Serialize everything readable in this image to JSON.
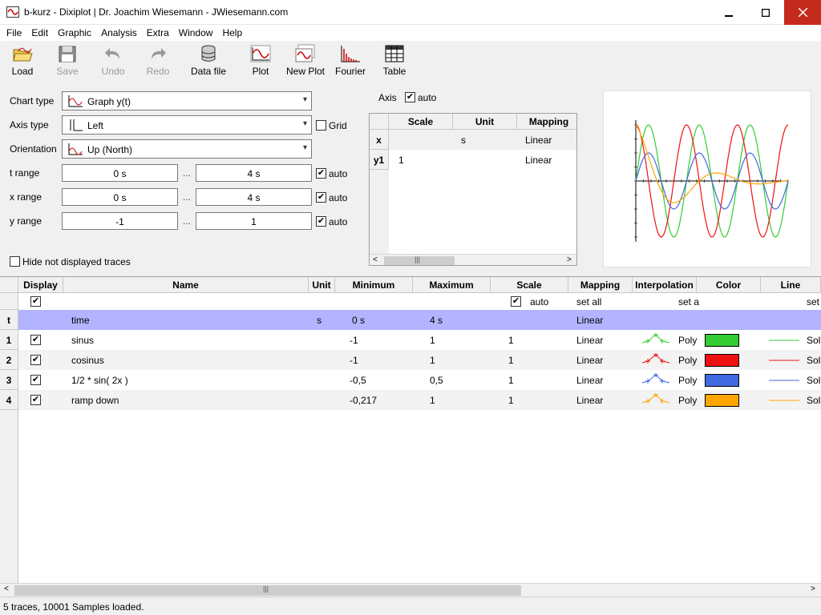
{
  "window": {
    "title": "b-kurz - Dixiplot | Dr. Joachim Wiesemann - JWiesemann.com",
    "min": "▁",
    "max": "☐",
    "close": "✕"
  },
  "menu": [
    "File",
    "Edit",
    "Graphic",
    "Analysis",
    "Extra",
    "Window",
    "Help"
  ],
  "toolbar": {
    "load": "Load",
    "save": "Save",
    "undo": "Undo",
    "redo": "Redo",
    "data_file": "Data file",
    "plot": "Plot",
    "new_plot": "New Plot",
    "fourier": "Fourier",
    "table": "Table"
  },
  "form": {
    "chart_type_label": "Chart type",
    "chart_type_value": "Graph y(t)",
    "axis_type_label": "Axis type",
    "axis_type_value": "Left",
    "grid_label": "Grid",
    "grid_checked": false,
    "orientation_label": "Orientation",
    "orientation_value": "Up (North)",
    "t_range_label": "t range",
    "t_min": "0 s",
    "t_max": "4 s",
    "x_range_label": "x range",
    "x_min": "0 s",
    "x_max": "4 s",
    "y_range_label": "y range",
    "y_min": "-1",
    "y_max": "1",
    "dots": "...",
    "auto_label": "auto",
    "hide_traces_label": "Hide not displayed traces"
  },
  "axis_panel": {
    "axis_label": "Axis",
    "auto_label": "auto",
    "headers": [
      "Scale",
      "Unit",
      "Mapping"
    ],
    "rows": [
      {
        "name": "x",
        "scale": "",
        "unit": "s",
        "mapping": "Linear"
      },
      {
        "name": "y1",
        "scale": "1",
        "unit": "",
        "mapping": "Linear"
      }
    ],
    "scroll_grip": "|||",
    "scroll_left": "<",
    "scroll_right": ">"
  },
  "main_grid": {
    "headers": [
      "Display",
      "Name",
      "Unit",
      "Minimum",
      "Maximum",
      "Scale",
      "Mapping",
      "Interpolation",
      "Color",
      "Line"
    ],
    "set_row": {
      "scale_auto": "auto",
      "mapping": "set all",
      "interp": "set a",
      "line": "set"
    },
    "time_row": {
      "num": "t",
      "name": "time",
      "unit": "s",
      "min": "0 s",
      "max": "4 s",
      "mapping": "Linear"
    },
    "rows": [
      {
        "num": "1",
        "name": "sinus",
        "min": "-1",
        "max": "1",
        "scale": "1",
        "mapping": "Linear",
        "interp": "Poly",
        "line": "Sol",
        "color": "#33cc33"
      },
      {
        "num": "2",
        "name": "cosinus",
        "min": "-1",
        "max": "1",
        "scale": "1",
        "mapping": "Linear",
        "interp": "Poly",
        "line": "Sol",
        "color": "#ee1111"
      },
      {
        "num": "3",
        "name": "1/2 * sin( 2x )",
        "min": "-0,5",
        "max": "0,5",
        "scale": "1",
        "mapping": "Linear",
        "interp": "Poly",
        "line": "Sol",
        "color": "#4169e1"
      },
      {
        "num": "4",
        "name": "ramp down",
        "min": "-0,217",
        "max": "1",
        "scale": "1",
        "mapping": "Linear",
        "interp": "Poly",
        "line": "Sol",
        "color": "#ffa500"
      }
    ],
    "scroll_grip": "|||",
    "scroll_left": "<",
    "scroll_right": ">"
  },
  "status": "5 traces, 10001 Samples loaded."
}
